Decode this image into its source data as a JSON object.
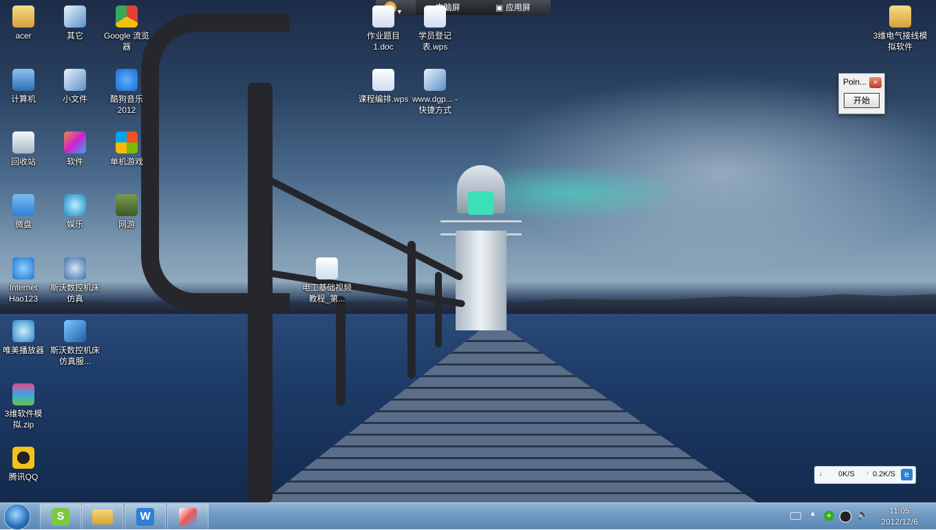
{
  "desktop_icons": [
    {
      "label": "acer",
      "icon": "folder-icon"
    },
    {
      "label": "其它",
      "icon": "shortcut-icon"
    },
    {
      "label": "Google 流览器",
      "icon": "chrome-icon"
    },
    {
      "label": "计算机",
      "icon": "computer-icon"
    },
    {
      "label": "小文件",
      "icon": "shortcut-icon"
    },
    {
      "label": "酷狗音乐2012",
      "icon": "kugou-icon"
    },
    {
      "label": "回收站",
      "icon": "recycle-bin-icon"
    },
    {
      "label": "软件",
      "icon": "cube-icon"
    },
    {
      "label": "单机游戏",
      "icon": "windows-flag-icon"
    },
    {
      "label": "微盘",
      "icon": "vdisk-icon"
    },
    {
      "label": "娱乐",
      "icon": "media-icon"
    },
    {
      "label": "网游",
      "icon": "gamepad-icon"
    },
    {
      "label": "Internet Hao123",
      "icon": "ie-icon"
    },
    {
      "label": "斯沃数控机床仿真",
      "icon": "cnc-icon"
    },
    {
      "label": "唯美播放器",
      "icon": "player-icon"
    },
    {
      "label": "斯沃数控机床仿真服...",
      "icon": "cnc-server-icon"
    },
    {
      "label": "3维软件模拟.zip",
      "icon": "zip-icon"
    },
    {
      "label": "腾讯QQ",
      "icon": "qq-icon"
    },
    {
      "label": "作业题目1.doc",
      "icon": "doc-icon"
    },
    {
      "label": "学员登记表.wps",
      "icon": "wps-doc-icon"
    },
    {
      "label": "课程编排.wps",
      "icon": "wps-doc-icon"
    },
    {
      "label": "www.dgp... - 快捷方式",
      "icon": "shortcut-icon"
    },
    {
      "label": "电工基础视频教程_第...",
      "icon": "wps-doc-icon"
    },
    {
      "label": "3维电气接线模拟软件",
      "icon": "folder-icon"
    }
  ],
  "top_bar": {
    "tab1": "电脑屏",
    "tab2": "应用屏"
  },
  "small_window": {
    "title": "Poin...",
    "close": "×",
    "button": "开始"
  },
  "net_monitor": {
    "down": "0K/S",
    "up": "0.2K/S"
  },
  "taskbar": {
    "apps": [
      "sogou-icon",
      "explorer-folder-icon",
      "wps-writer-icon",
      "paint-app-icon"
    ]
  },
  "clock": {
    "time": "11:05",
    "date": "2012/12/6"
  },
  "colors": {
    "taskbar": "#6f99c2",
    "accent_teal": "#3be0b8"
  }
}
